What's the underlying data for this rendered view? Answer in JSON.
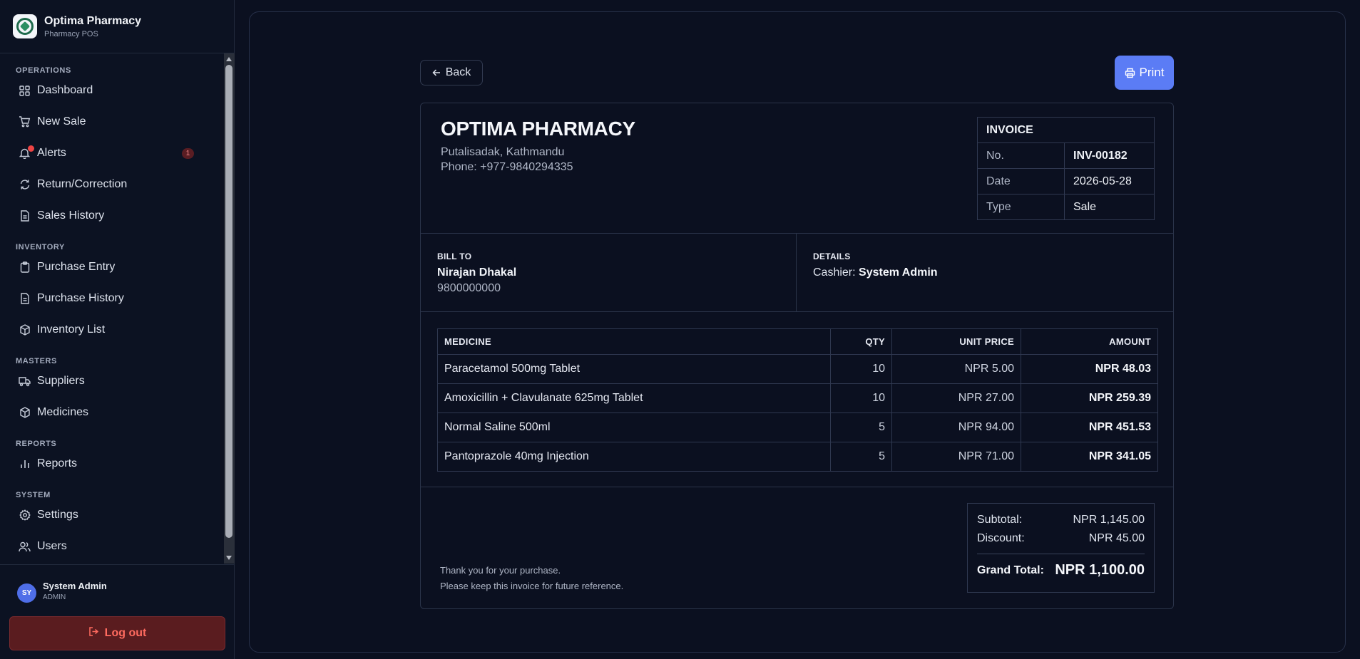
{
  "brand": {
    "title": "Optima Pharmacy",
    "subtitle": "Pharmacy POS"
  },
  "nav": {
    "sections": {
      "operations": "OPERATIONS",
      "inventory": "INVENTORY",
      "masters": "MASTERS",
      "reports": "REPORTS",
      "system": "SYSTEM"
    },
    "items": {
      "dashboard": "Dashboard",
      "new_sale": "New Sale",
      "alerts": "Alerts",
      "alerts_badge": "1",
      "return_correction": "Return/Correction",
      "sales_history": "Sales History",
      "purchase_entry": "Purchase Entry",
      "purchase_history": "Purchase History",
      "inventory_list": "Inventory List",
      "suppliers": "Suppliers",
      "medicines": "Medicines",
      "reports": "Reports",
      "settings": "Settings",
      "users": "Users"
    }
  },
  "user": {
    "initials": "SY",
    "name": "System Admin",
    "role": "ADMIN",
    "logout_label": "Log out"
  },
  "actions": {
    "back_label": "Back",
    "print_label": "Print"
  },
  "invoice": {
    "shop_name": "OPTIMA PHARMACY",
    "address": "Putalisadak, Kathmandu",
    "phone": "Phone: +977-9840294335",
    "meta": {
      "heading": "INVOICE",
      "no_label": "No.",
      "no_value": "INV-00182",
      "date_label": "Date",
      "date_value": "2026-05-28",
      "type_label": "Type",
      "type_value": "Sale"
    },
    "bill_to": {
      "label": "BILL TO",
      "name": "Nirajan Dhakal",
      "phone": "9800000000"
    },
    "details": {
      "label": "DETAILS",
      "cashier_label": "Cashier:",
      "cashier_name": "System Admin"
    },
    "columns": {
      "medicine": "MEDICINE",
      "qty": "QTY",
      "unit_price": "UNIT PRICE",
      "amount": "AMOUNT"
    },
    "items": [
      {
        "medicine": "Paracetamol 500mg Tablet",
        "qty": "10",
        "unit_price": "NPR 5.00",
        "amount": "NPR 48.03"
      },
      {
        "medicine": "Amoxicillin + Clavulanate 625mg Tablet",
        "qty": "10",
        "unit_price": "NPR 27.00",
        "amount": "NPR 259.39"
      },
      {
        "medicine": "Normal Saline 500ml",
        "qty": "5",
        "unit_price": "NPR 94.00",
        "amount": "NPR 451.53"
      },
      {
        "medicine": "Pantoprazole 40mg Injection",
        "qty": "5",
        "unit_price": "NPR 71.00",
        "amount": "NPR 341.05"
      }
    ],
    "totals": {
      "subtotal_label": "Subtotal:",
      "subtotal": "NPR 1,145.00",
      "discount_label": "Discount:",
      "discount": "NPR 45.00",
      "grand_label": "Grand Total:",
      "grand": "NPR 1,100.00"
    },
    "footer": {
      "line1": "Thank you for your purchase.",
      "line2": "Please keep this invoice for future reference."
    }
  },
  "colors": {
    "accent": "#5b7cf5",
    "danger_bg": "#5a1c1f",
    "danger_text": "#ff6b5f",
    "background": "#0b1020"
  }
}
